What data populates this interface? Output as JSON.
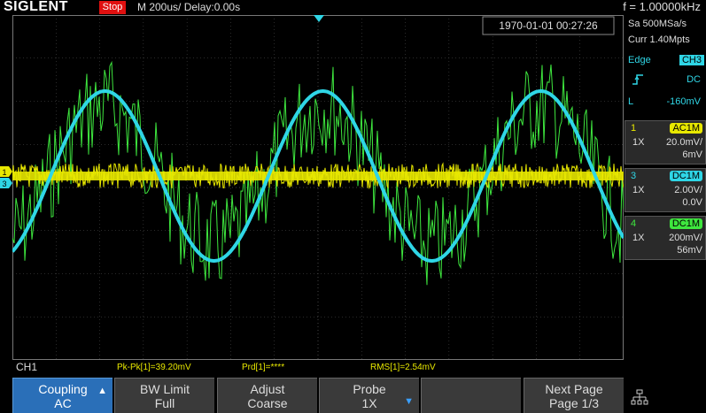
{
  "header": {
    "logo": "SIGLENT",
    "run_state": "Stop",
    "timebase": "M 200us/  Delay:0.00s",
    "frequency": "f = 1.00000kHz"
  },
  "screen": {
    "timestamp": "1970-01-01 00:27:26"
  },
  "right_panel": {
    "sample_rate": "Sa 500MSa/s",
    "memory_depth": "Curr 1.40Mpts",
    "trigger_type": "Edge",
    "trigger_source": "CH3",
    "trigger_slope_icon": "rising-edge-icon",
    "trigger_coupling": "DC",
    "trigger_level_prefix": "L",
    "trigger_level": "-160mV",
    "channels": [
      {
        "num": "1",
        "coupling": "AC1M",
        "probe": "1X",
        "scale": "20.0mV/",
        "offset": "6mV",
        "color": "#e8e800"
      },
      {
        "num": "3",
        "coupling": "DC1M",
        "probe": "1X",
        "scale": "2.00V/",
        "offset": "0.0V",
        "color": "#2fd6e6"
      },
      {
        "num": "4",
        "coupling": "DC1M",
        "probe": "1X",
        "scale": "200mV/",
        "offset": "56mV",
        "color": "#3ee63e"
      }
    ]
  },
  "measurements": {
    "channel": "CH1",
    "pkpk": "Pk-Pk[1]=39.20mV",
    "prd": "Prd[1]=****",
    "rms": "RMS[1]=2.54mV"
  },
  "softkeys": [
    {
      "line1": "Coupling",
      "line2": "AC",
      "arrow": "up"
    },
    {
      "line1": "BW Limit",
      "line2": "Full",
      "arrow": ""
    },
    {
      "line1": "Adjust",
      "line2": "Coarse",
      "arrow": ""
    },
    {
      "line1": "Probe",
      "line2": "1X",
      "arrow": "down"
    },
    {
      "line1": "",
      "line2": "",
      "arrow": ""
    },
    {
      "line1": "Next Page",
      "line2": "Page 1/3",
      "arrow": ""
    }
  ],
  "markers": {
    "ch1_marker": "1",
    "ch3_marker": "3"
  },
  "colors": {
    "ch1": "#e8e800",
    "ch3": "#2fd6e6",
    "ch4": "#3ee63e",
    "grid": "#555555",
    "stop": "#e01010",
    "softkey_active": "#2a6fb8"
  }
}
